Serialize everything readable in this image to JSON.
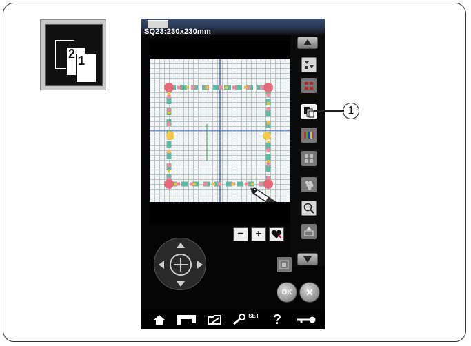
{
  "screen": {
    "title": "SQ23:230x230mm"
  },
  "controls": {
    "minus_label": "−",
    "plus_label": "+"
  },
  "buttons": {
    "ok_label": "OK",
    "cancel_label": "✕"
  },
  "bottom_bar": {
    "set_label": "SET",
    "help_label": "?"
  },
  "callout": {
    "number": "1"
  },
  "big_icon": {
    "page_back_label": "2",
    "page_mid_label": "1"
  },
  "toolbar": {
    "icons": [
      "layout-icon",
      "color-grid-icon",
      "page-order-icon",
      "color-bar-icon",
      "layout-grid-icon",
      "grapes-icon",
      "zoom-icon",
      "export-icon"
    ]
  },
  "colors": {
    "accent_red": "#c0103a",
    "grid_line": "#b5c5c8",
    "axis_blue": "#3355aa"
  }
}
